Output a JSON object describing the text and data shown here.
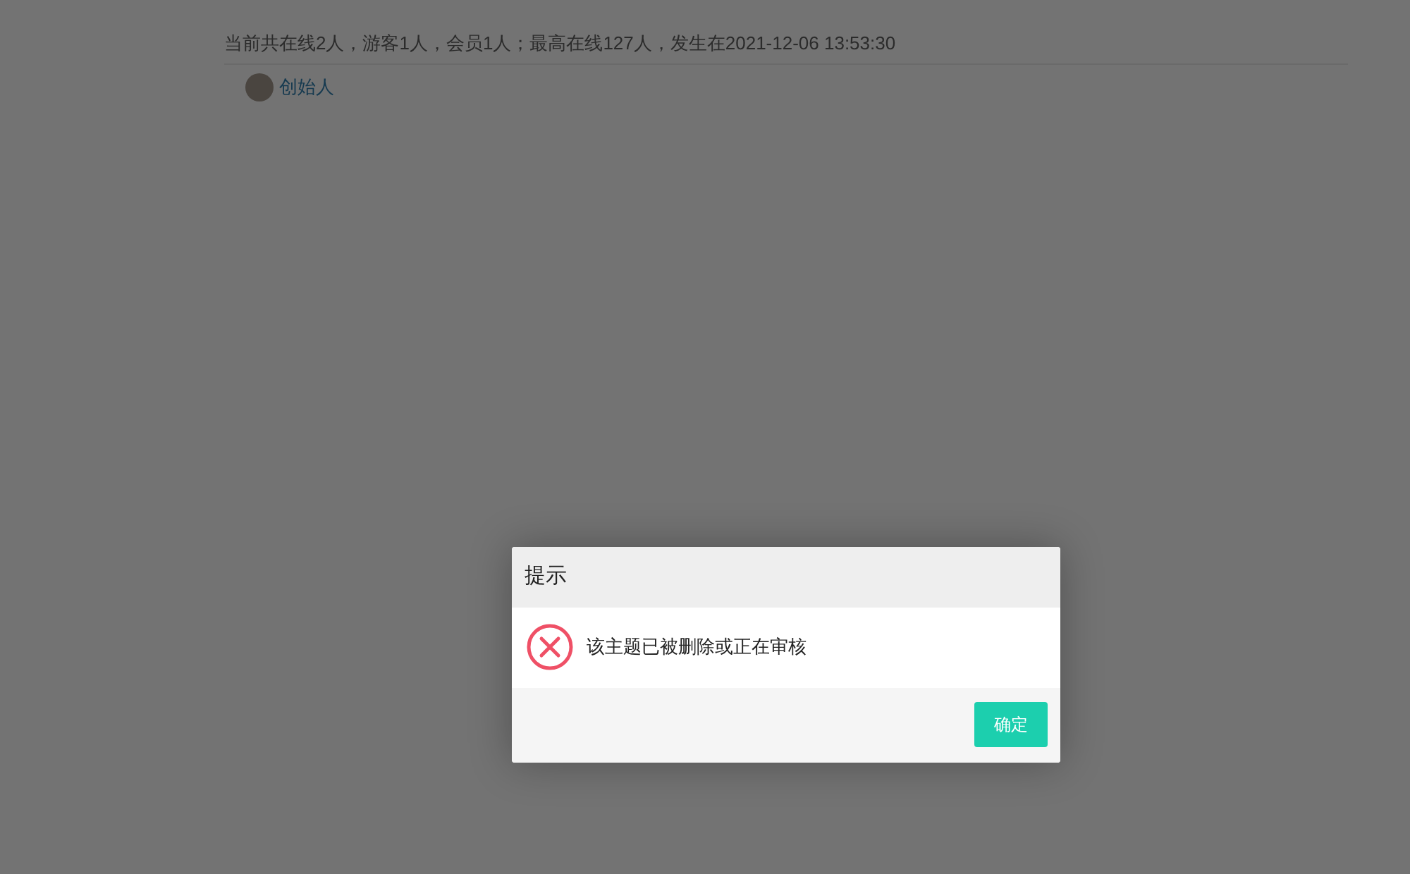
{
  "online_stats": "当前共在线2人，游客1人，会员1人；最高在线127人，发生在2021-12-06 13:53:30",
  "members": [
    {
      "name": "创始人"
    }
  ],
  "dialog": {
    "title": "提示",
    "message": "该主题已被删除或正在审核",
    "buttons": [
      "确定"
    ]
  }
}
